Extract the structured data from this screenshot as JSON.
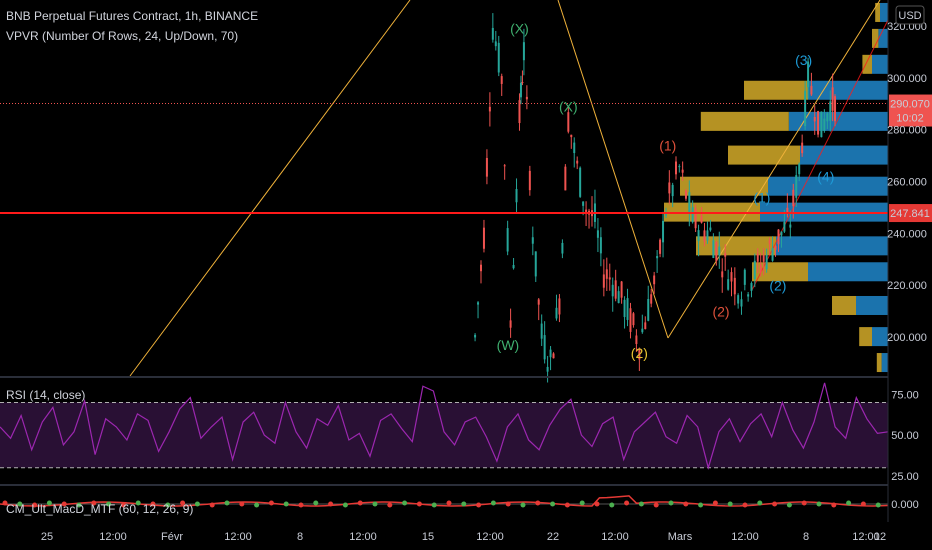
{
  "header": {
    "title": "BNB Perpetual Futures Contract, 1h, BINANCE",
    "indicator": "VPVR (Number Of Rows, 24, Up/Down, 70)"
  },
  "colors": {
    "up": "#26a69a",
    "down": "#ef5350",
    "vp_up": "#1e7fc0",
    "vp_down": "#c9a227",
    "rsi": "#9c27b0",
    "hline": "#ff1a1a",
    "trend": "#f0b23a",
    "wave_green": "#3fae6e",
    "wave_red": "#e0513b",
    "wave_blue": "#1e9bd7",
    "wave_yellow": "#e8c331"
  },
  "chart_data": [
    {
      "type": "candlestick",
      "title": "BNB Perpetual Futures Contract, 1h, BINANCE",
      "price_axis_unit": "USD",
      "ylim": [
        185,
        330
      ],
      "y_ticks": [
        200,
        220,
        240,
        260,
        280,
        300,
        320
      ],
      "x_ticks": [
        "25",
        "12:00",
        "Févr",
        "12:00",
        "8",
        "12:00",
        "15",
        "12:00",
        "22",
        "12:00",
        "Mars",
        "12:00",
        "8",
        "12:00",
        "12"
      ],
      "price_path": [
        [
          0.535,
          200
        ],
        [
          0.545,
          240
        ],
        [
          0.555,
          320
        ],
        [
          0.565,
          300
        ],
        [
          0.575,
          205
        ],
        [
          0.585,
          285
        ],
        [
          0.59,
          310
        ],
        [
          0.6,
          240
        ],
        [
          0.61,
          200
        ],
        [
          0.62,
          190
        ],
        [
          0.63,
          215
        ],
        [
          0.64,
          285
        ],
        [
          0.65,
          265
        ],
        [
          0.66,
          250
        ],
        [
          0.67,
          245
        ],
        [
          0.68,
          225
        ],
        [
          0.69,
          222
        ],
        [
          0.7,
          215
        ],
        [
          0.72,
          198
        ],
        [
          0.74,
          225
        ],
        [
          0.75,
          250
        ],
        [
          0.765,
          265
        ],
        [
          0.78,
          245
        ],
        [
          0.8,
          240
        ],
        [
          0.82,
          225
        ],
        [
          0.835,
          218
        ],
        [
          0.85,
          225
        ],
        [
          0.87,
          235
        ],
        [
          0.89,
          245
        ],
        [
          0.9,
          265
        ],
        [
          0.91,
          300
        ],
        [
          0.925,
          280
        ],
        [
          0.935,
          290
        ],
        [
          0.943,
          290.07
        ]
      ],
      "hlines": [
        {
          "value": 247.841,
          "label": "247.841"
        },
        {
          "value": 290.07,
          "label": "290.070",
          "sublabel": "10:02"
        }
      ],
      "volume_profile": [
        {
          "price": 325,
          "up": 0.05,
          "down": 0.03
        },
        {
          "price": 315,
          "up": 0.06,
          "down": 0.04
        },
        {
          "price": 305,
          "up": 0.1,
          "down": 0.06
        },
        {
          "price": 295,
          "up": 0.5,
          "down": 0.4
        },
        {
          "price": 283,
          "up": 0.62,
          "down": 0.55
        },
        {
          "price": 270,
          "up": 0.55,
          "down": 0.45
        },
        {
          "price": 258,
          "up": 0.75,
          "down": 0.55
        },
        {
          "price": 248,
          "up": 0.8,
          "down": 0.6
        },
        {
          "price": 235,
          "up": 0.7,
          "down": 0.5
        },
        {
          "price": 225,
          "up": 0.5,
          "down": 0.35
        },
        {
          "price": 212,
          "up": 0.2,
          "down": 0.15
        },
        {
          "price": 200,
          "up": 0.1,
          "down": 0.08
        },
        {
          "price": 190,
          "up": 0.04,
          "down": 0.03
        }
      ],
      "wave_labels": [
        {
          "text": "(X)",
          "price": 317,
          "t": 0.585,
          "color": "wave_green"
        },
        {
          "text": "(X)",
          "price": 287,
          "t": 0.64,
          "color": "wave_green"
        },
        {
          "text": "(W)",
          "price": 195,
          "t": 0.572,
          "color": "wave_green"
        },
        {
          "text": "(1)",
          "price": 272,
          "t": 0.752,
          "color": "wave_red"
        },
        {
          "text": "(2)",
          "price": 208,
          "t": 0.812,
          "color": "wave_red"
        },
        {
          "text": "(2)",
          "price": 192,
          "t": 0.72,
          "color": "wave_yellow"
        },
        {
          "text": "(2)",
          "price": 218,
          "t": 0.876,
          "color": "wave_blue"
        },
        {
          "text": "(3)",
          "price": 305,
          "t": 0.905,
          "color": "wave_blue"
        },
        {
          "text": "(4)",
          "price": 260,
          "t": 0.93,
          "color": "wave_blue"
        },
        {
          "text": "(1)",
          "price": 252,
          "t": 0.858,
          "color": "wave_blue"
        }
      ]
    },
    {
      "type": "line",
      "title": "RSI (14, close)",
      "ylim": [
        20,
        85
      ],
      "y_ticks": [
        25,
        50,
        75
      ],
      "bands": [
        30,
        70
      ],
      "values": [
        55,
        48,
        62,
        41,
        58,
        67,
        44,
        52,
        71,
        38,
        60,
        55,
        47,
        63,
        59,
        40,
        52,
        66,
        73,
        48,
        55,
        61,
        35,
        58,
        64,
        50,
        45,
        70,
        52,
        42,
        60,
        56,
        68,
        47,
        51,
        37,
        59,
        63,
        54,
        46,
        80,
        77,
        52,
        44,
        58,
        61,
        49,
        34,
        55,
        63,
        47,
        41,
        56,
        66,
        72,
        50,
        43,
        57,
        61,
        35,
        52,
        58,
        64,
        49,
        45,
        62,
        55,
        30,
        52,
        60,
        46,
        57,
        63,
        49,
        70,
        53,
        42,
        58,
        82,
        55,
        48,
        73,
        60,
        51,
        52
      ]
    },
    {
      "type": "line",
      "title": "CM_Ult_MacD_MTF (60, 12, 26, 9)",
      "y_ticks": [
        0
      ],
      "y_tick_labels": [
        "0.000"
      ]
    }
  ]
}
